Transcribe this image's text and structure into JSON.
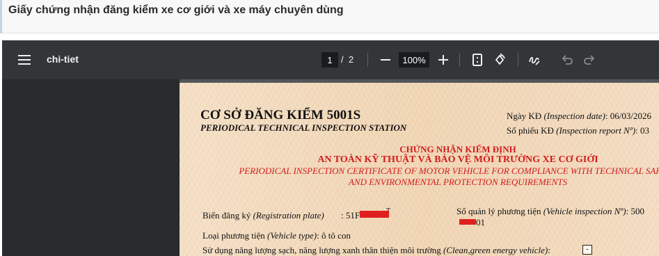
{
  "header": {
    "title": "Giấy chứng nhận đăng kiểm xe cơ giới và xe máy chuyên dùng"
  },
  "viewer": {
    "document_name": "chi-tiet",
    "current_page": "1",
    "page_separator": "/",
    "total_pages": "2",
    "zoom": "100%"
  },
  "certificate": {
    "station_name": "CƠ SỞ ĐĂNG KIỂM 5001S",
    "station_name_en": "PERIODICAL TECHNICAL INSPECTION STATION",
    "inspection_date_label": "Ngày KĐ",
    "inspection_date_en": "(Inspection date)",
    "inspection_date_value": ": 06/03/2026",
    "report_no_label": "Số phiếu KĐ",
    "report_no_en": "(Inspection report Nº)",
    "report_no_value": ": 03",
    "title_line1": "CHỨNG NHẬN KIỂM ĐỊNH",
    "title_line2": "AN TOÀN KỸ THUẬT VÀ BẢO VỆ MÔI TRƯỜNG XE CƠ GIỚI",
    "title_line3": "PERIODICAL INSPECTION CERTIFICATE OF MOTOR VEHICLE FOR COMPLIANCE WITH TECHNICAL SAFETY",
    "title_line4": "AND ENVIRONMENTAL PROTECTION REQUIREMENTS",
    "registration_label": "Biển đăng ký",
    "registration_en": "(Registration plate)",
    "registration_value": ":  51F-",
    "registration_suffix": "T",
    "management_label": "Số quản lý phương tiện",
    "management_en": "(Vehicle inspection Nº)",
    "management_value": ": 500",
    "management_suffix": "01",
    "vehicle_type_label": "Loại phương tiện",
    "vehicle_type_en": "(Vehicle type)",
    "vehicle_type_value": ": ô tô con",
    "energy_label": "Sử dụng năng lượng sạch, năng lượng xanh thân thiện môi trường",
    "energy_en": "(Clean,green energy vehicle)",
    "energy_colon": ":",
    "energy_value": "-"
  },
  "colors": {
    "toolbar": "#323639",
    "viewer_bg": "#525659",
    "sidebar": "#2a2b2d",
    "cert_red": "#d21c1c",
    "paper": "#f3dcc0"
  },
  "icons": [
    "menu-icon",
    "zoom-out-icon",
    "zoom-in-icon",
    "fit-page-icon",
    "rotate-icon",
    "annotate-icon",
    "undo-icon",
    "redo-icon"
  ]
}
